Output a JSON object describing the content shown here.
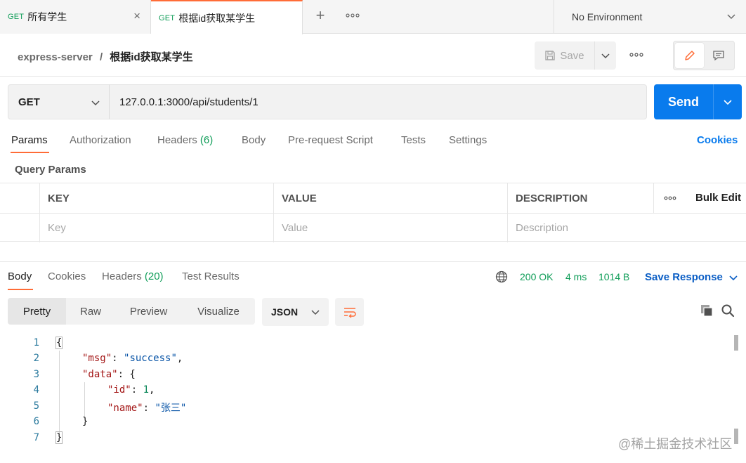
{
  "tabs": [
    {
      "method": "GET",
      "title": "所有学生",
      "close": "×"
    },
    {
      "method": "GET",
      "title": "根据id获取某学生"
    }
  ],
  "tab_add": "+",
  "tab_more": "ooo",
  "environment": "No Environment",
  "breadcrumb": {
    "collection": "express-server",
    "separator": "/",
    "current": "根据id获取某学生"
  },
  "save_label": "Save",
  "more_label": "ooo",
  "request": {
    "method": "GET",
    "url": "127.0.0.1:3000/api/students/1",
    "send_label": "Send"
  },
  "request_tabs": {
    "params": "Params",
    "authorization": "Authorization",
    "headers": "Headers",
    "headers_count": "(6)",
    "body": "Body",
    "prerequest": "Pre-request Script",
    "tests": "Tests",
    "settings": "Settings",
    "cookies": "Cookies"
  },
  "query_params": {
    "title": "Query Params",
    "columns": {
      "key": "KEY",
      "value": "VALUE",
      "description": "DESCRIPTION"
    },
    "more": "ooo",
    "bulk_edit": "Bulk Edit",
    "placeholders": {
      "key": "Key",
      "value": "Value",
      "description": "Description"
    }
  },
  "response_tabs": {
    "body": "Body",
    "cookies": "Cookies",
    "headers": "Headers",
    "headers_count": "(20)",
    "test_results": "Test Results"
  },
  "response_status": {
    "status": "200 OK",
    "time": "4 ms",
    "size": "1014 B",
    "save_response": "Save Response"
  },
  "view_tabs": [
    "Pretty",
    "Raw",
    "Preview",
    "Visualize"
  ],
  "format": "JSON",
  "code": {
    "line_numbers": [
      "1",
      "2",
      "3",
      "4",
      "5",
      "6",
      "7"
    ],
    "open_brace": "{",
    "msg_key": "\"msg\"",
    "msg_val": "\"success\"",
    "data_key": "\"data\"",
    "id_key": "\"id\"",
    "id_val": "1",
    "name_key": "\"name\"",
    "name_val": "\"张三\"",
    "inner_close": "}",
    "close_brace": "}"
  },
  "watermark": "@稀土掘金技术社区",
  "colors": {
    "accent": "#ff6c37",
    "send": "#097bed",
    "success": "#0f9d58",
    "link": "#0b5ec5"
  }
}
